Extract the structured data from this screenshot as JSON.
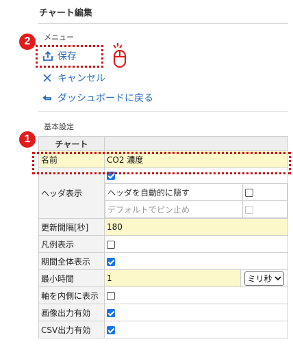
{
  "header": {
    "title": "チャート編集"
  },
  "menu": {
    "section_label": "メニュー",
    "items": [
      {
        "label": "保存",
        "icon": "upload-icon"
      },
      {
        "label": "キャンセル",
        "icon": "close-icon"
      },
      {
        "label": "ダッシュボードに戻る",
        "icon": "back-arrow-icon"
      }
    ]
  },
  "annotations": {
    "badge_1": "1",
    "badge_2": "2",
    "color": "#e21b1b"
  },
  "settings": {
    "section_label": "基本設定",
    "table_header": "チャート",
    "rows": {
      "name": {
        "label": "名前",
        "value": "CO2 濃度"
      },
      "header_display": {
        "label": "ヘッダ表示",
        "checked": true,
        "auto_hide_label": "ヘッダを自動的に隠す",
        "auto_hide_checked": false,
        "pin_default_label": "デフォルトでピン止め",
        "pin_default_checked": false,
        "pin_default_disabled": true
      },
      "update_interval": {
        "label": "更新間隔[秒]",
        "value": "180"
      },
      "legend": {
        "label": "凡例表示",
        "checked": false
      },
      "full_period": {
        "label": "期間全体表示",
        "checked": true
      },
      "min_time": {
        "label": "最小時間",
        "value": "1",
        "unit": "ミリ秒"
      },
      "axis_inside": {
        "label": "軸を内側に表示",
        "checked": false
      },
      "image_output": {
        "label": "画像出力有効",
        "checked": true
      },
      "csv_output": {
        "label": "CSV出力有効",
        "checked": true
      }
    }
  },
  "colors": {
    "link": "#2a6bbf",
    "input_bg": "#fdf8c9",
    "checkbox_on": "#1a73e8"
  }
}
